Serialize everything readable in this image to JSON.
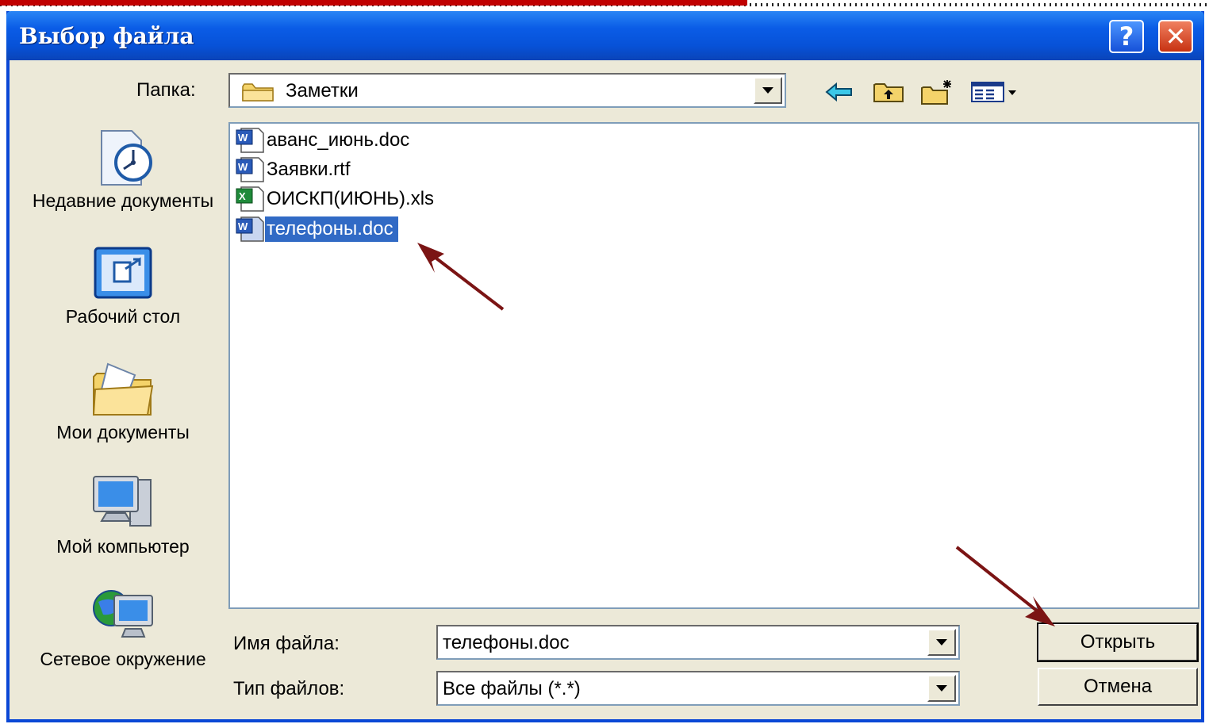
{
  "window": {
    "title": "Выбор файла",
    "help_label": "?",
    "close_label": "✕"
  },
  "toolbar": {
    "folder_label": "Папка:",
    "current_folder": "Заметки"
  },
  "places": [
    {
      "id": "recent",
      "label": "Недавние документы",
      "icon": "recent-documents-icon"
    },
    {
      "id": "desktop",
      "label": "Рабочий стол",
      "icon": "desktop-icon"
    },
    {
      "id": "mydocs",
      "label": "Мои документы",
      "icon": "my-documents-icon"
    },
    {
      "id": "mycomp",
      "label": "Мой компьютер",
      "icon": "my-computer-icon"
    },
    {
      "id": "network",
      "label": "Сетевое окружение",
      "icon": "network-icon"
    }
  ],
  "files": [
    {
      "name": "аванс_июнь.doc",
      "type": "word"
    },
    {
      "name": "Заявки.rtf",
      "type": "word"
    },
    {
      "name": "ОИСКП(ИЮНЬ).xls",
      "type": "excel"
    },
    {
      "name": "телефоны.doc",
      "type": "word",
      "selected": true
    }
  ],
  "form": {
    "filename_label": "Имя файла:",
    "filename_value": "телефоны.doc",
    "filetype_label": "Тип файлов:",
    "filetype_value": "Все файлы (*.*)"
  },
  "buttons": {
    "open": "Открыть",
    "cancel": "Отмена"
  },
  "colors": {
    "title_bar": "#0a5ce6",
    "selection": "#316ac5",
    "annotation_arrow": "#7b1414",
    "dialog_bg": "#ece9d8"
  }
}
